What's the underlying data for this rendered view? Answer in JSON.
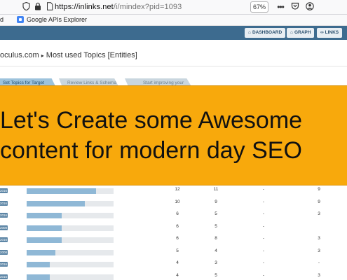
{
  "browser": {
    "url_host": "https://inlinks.net",
    "url_path": "/i/mindex?pid=1093",
    "zoom": "67%",
    "icons": [
      "shield-icon",
      "lock-icon",
      "page-icon",
      "more-icon",
      "pocket-icon",
      "account-icon"
    ]
  },
  "bookmarks": {
    "partial": "d",
    "item_label": "Google APIs Explorer"
  },
  "nav": {
    "dashboard": "DASHBOARD",
    "graph": "GRAPH",
    "links": "LINKS",
    "dashboard_icon": "⌂",
    "graph_icon": "⌂",
    "links_icon": "∞"
  },
  "breadcrumb": {
    "site": "oculus.com",
    "separator": "▸",
    "page": "Most used Topics [Entities]"
  },
  "steps": [
    {
      "label": "Set Topics for Target"
    },
    {
      "label": "Review Links & Schema"
    },
    {
      "label": "Start improving your"
    }
  ],
  "banner": {
    "line1": "Let's Create some Awesome",
    "line2": "content for modern day SEO"
  },
  "table": {
    "rows": [
      {
        "tag": "2016",
        "fill": 0.8,
        "c1": "12",
        "c2": "11",
        "c3": "-",
        "c4": "9",
        "c5": ""
      },
      {
        "tag": "2016",
        "fill": 0.67,
        "c1": "10",
        "c2": "9",
        "c3": "-",
        "c4": "9",
        "c5": ""
      },
      {
        "tag": "2016",
        "fill": 0.4,
        "c1": "6",
        "c2": "5",
        "c3": "-",
        "c4": "3",
        "c5": ""
      },
      {
        "tag": "2008",
        "fill": 0.4,
        "c1": "6",
        "c2": "5",
        "c3": "-",
        "c4": "",
        "c5": ""
      },
      {
        "tag": "2016",
        "fill": 0.4,
        "c1": "6",
        "c2": "8",
        "c3": "-",
        "c4": "3",
        "c5": ""
      },
      {
        "tag": "2008",
        "fill": 0.33,
        "c1": "5",
        "c2": "4",
        "c3": "-",
        "c4": "3",
        "c5": ""
      },
      {
        "tag": "2016",
        "fill": 0.27,
        "c1": "4",
        "c2": "3",
        "c3": "-",
        "c4": "-",
        "c5": ""
      },
      {
        "tag": "2016",
        "fill": 0.27,
        "c1": "4",
        "c2": "5",
        "c3": "-",
        "c4": "3",
        "c5": ""
      }
    ]
  }
}
